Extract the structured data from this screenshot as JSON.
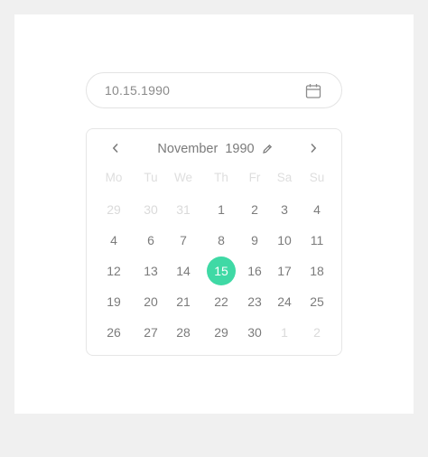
{
  "date_input": {
    "value": "10.15.1990",
    "icon": "calendar-icon"
  },
  "calendar": {
    "month": "November",
    "year": "1990",
    "weekdays": [
      "Mo",
      "Tu",
      "We",
      "Th",
      "Fr",
      "Sa",
      "Su"
    ],
    "weeks": [
      [
        {
          "d": "29",
          "m": true
        },
        {
          "d": "30",
          "m": true
        },
        {
          "d": "31",
          "m": true
        },
        {
          "d": "1"
        },
        {
          "d": "2"
        },
        {
          "d": "3"
        },
        {
          "d": "4"
        }
      ],
      [
        {
          "d": "4"
        },
        {
          "d": "6"
        },
        {
          "d": "7"
        },
        {
          "d": "8"
        },
        {
          "d": "9"
        },
        {
          "d": "10"
        },
        {
          "d": "11"
        }
      ],
      [
        {
          "d": "12"
        },
        {
          "d": "13"
        },
        {
          "d": "14"
        },
        {
          "d": "15",
          "s": true
        },
        {
          "d": "16"
        },
        {
          "d": "17"
        },
        {
          "d": "18"
        }
      ],
      [
        {
          "d": "19"
        },
        {
          "d": "20"
        },
        {
          "d": "21"
        },
        {
          "d": "22"
        },
        {
          "d": "23"
        },
        {
          "d": "24"
        },
        {
          "d": "25"
        }
      ],
      [
        {
          "d": "26"
        },
        {
          "d": "27"
        },
        {
          "d": "28"
        },
        {
          "d": "29"
        },
        {
          "d": "30"
        },
        {
          "d": "1",
          "m": true
        },
        {
          "d": "2",
          "m": true
        }
      ]
    ],
    "selected_color": "#3fd9a5"
  }
}
